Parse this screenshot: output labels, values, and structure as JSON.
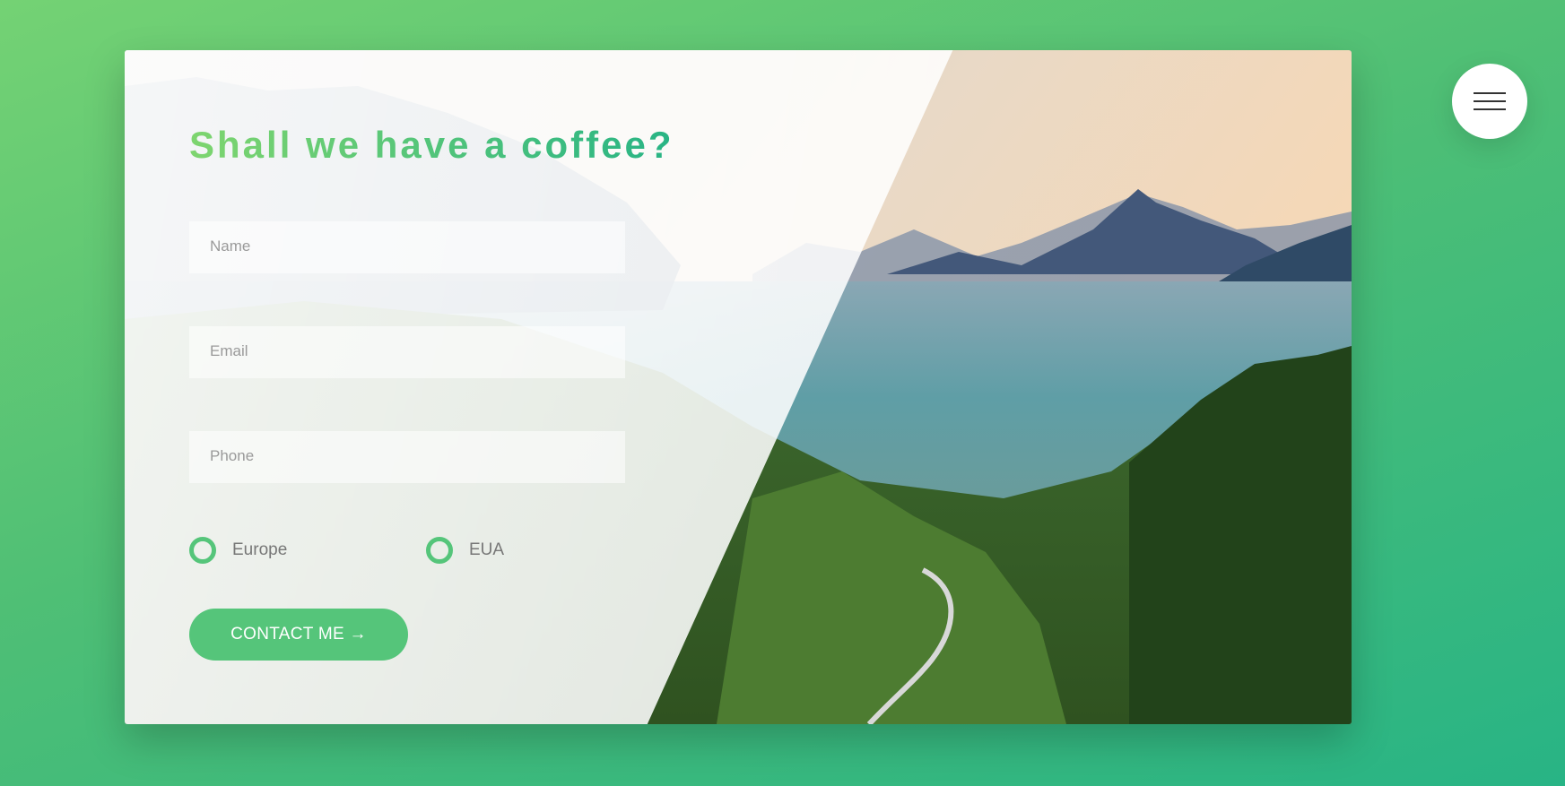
{
  "form": {
    "heading": "Shall we have a coffee?",
    "name_placeholder": "Name",
    "email_placeholder": "Email",
    "phone_placeholder": "Phone",
    "radio_options": [
      {
        "label": "Europe",
        "checked": false
      },
      {
        "label": "EUA",
        "checked": false
      }
    ],
    "submit_label": "CONTACT ME →"
  },
  "navigation": {
    "menu_icon": "hamburger-icon"
  },
  "image": {
    "description_icon": "landscape-photo"
  },
  "colors": {
    "primary_green": "#55c57a",
    "gradient_light": "#7ed56f",
    "gradient_dark": "#28b485",
    "label_gray": "#777777"
  }
}
